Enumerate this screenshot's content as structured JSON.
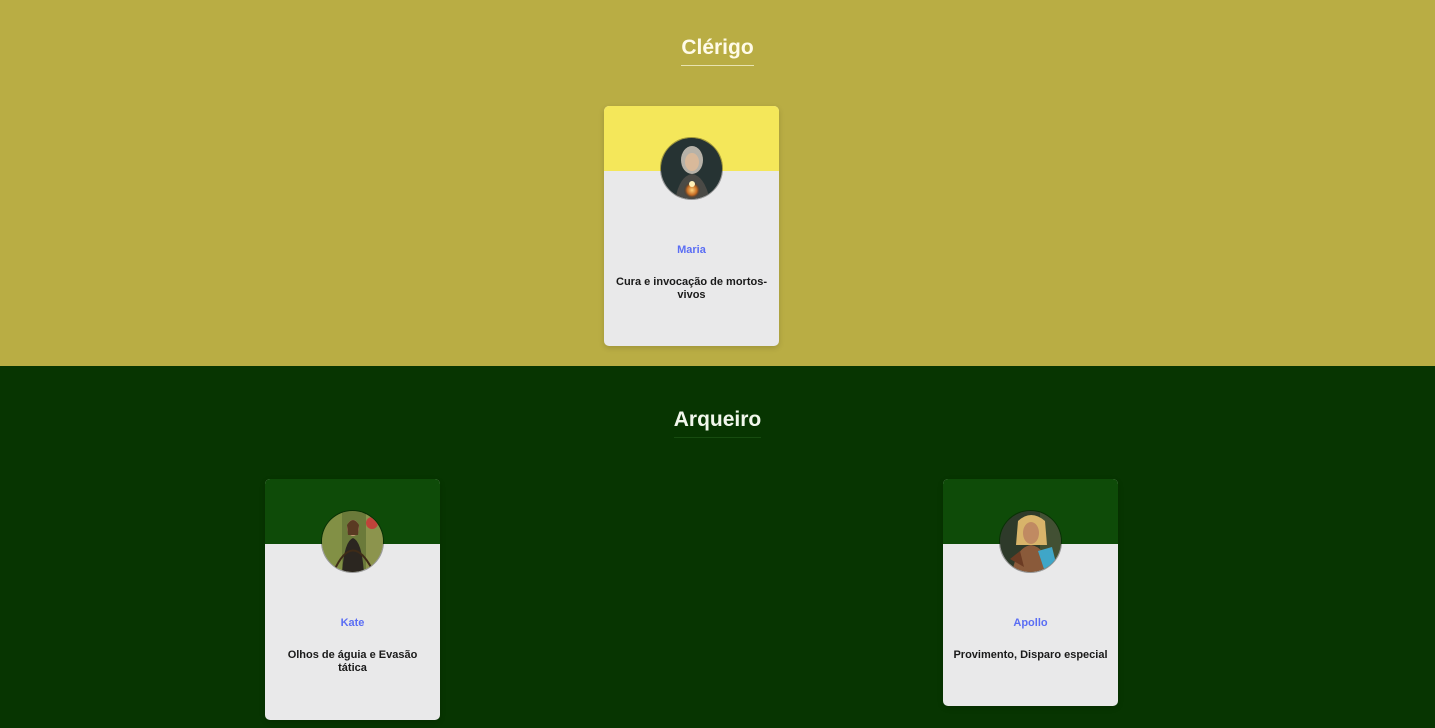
{
  "sections": [
    {
      "title": "Clérigo",
      "background": "#b9ad44",
      "cards": [
        {
          "name": "Maria",
          "description": "Cura e invocação de mortos-vivos",
          "header_color": "#f4e75a",
          "avatar": "cleric-portrait-avatar"
        }
      ]
    },
    {
      "title": "Arqueiro",
      "background": "#073501",
      "cards": [
        {
          "name": "Kate",
          "description": "Olhos de águia e Evasão tática",
          "header_color": "#0e4b08",
          "avatar": "archer-woman-portrait-avatar"
        },
        {
          "name": "Apollo",
          "description": "Provimento, Disparo especial",
          "header_color": "#0e4b08",
          "avatar": "archer-man-portrait-avatar"
        }
      ]
    }
  ],
  "colors": {
    "name_text": "#5b6ef4",
    "card_body": "#e9e9ea"
  }
}
